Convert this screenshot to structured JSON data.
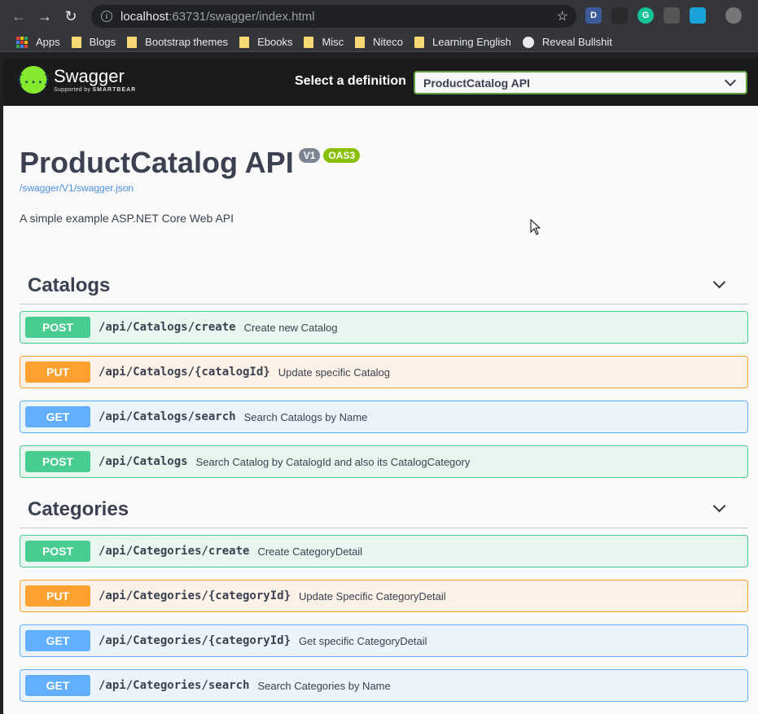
{
  "browser": {
    "url_host": "localhost",
    "url_rest": ":63731/swagger/index.html",
    "extensions": [
      {
        "name": "d-extension-icon",
        "letter": "D",
        "bg": "#3d5a98"
      },
      {
        "name": "dark-extension-icon",
        "letter": "",
        "bg": "#2a2a2a"
      },
      {
        "name": "grammarly-icon",
        "letter": "G",
        "bg": "#15c39a"
      },
      {
        "name": "bulb-extension-icon",
        "letter": "",
        "bg": "#555"
      },
      {
        "name": "blue-extension-icon",
        "letter": "",
        "bg": "#1aa3d9"
      },
      {
        "name": "profile-avatar-icon",
        "letter": "",
        "bg": "#777"
      }
    ],
    "bookmarks": [
      {
        "label": "Apps",
        "type": "apps"
      },
      {
        "label": "Blogs",
        "type": "folder"
      },
      {
        "label": "Bootstrap themes",
        "type": "folder"
      },
      {
        "label": "Ebooks",
        "type": "folder"
      },
      {
        "label": "Misc",
        "type": "folder"
      },
      {
        "label": "Niteco",
        "type": "folder"
      },
      {
        "label": "Learning English",
        "type": "folder"
      },
      {
        "label": "Reveal Bullshit",
        "type": "globe"
      }
    ]
  },
  "topbar": {
    "brand": "Swagger",
    "logo_glyph": "{...}",
    "supported_by": "Supported by",
    "smartbear": "SMARTBEAR",
    "select_label": "Select a definition",
    "selected_definition": "ProductCatalog API"
  },
  "info": {
    "title": "ProductCatalog API",
    "version_badge": "V1",
    "oas_badge": "OAS3",
    "json_link": "/swagger/V1/swagger.json",
    "description": "A simple example ASP.NET Core Web API"
  },
  "tags": [
    {
      "name": "Catalogs",
      "operations": [
        {
          "method": "POST",
          "path": "/api/Catalogs/create",
          "summary": "Create new Catalog"
        },
        {
          "method": "PUT",
          "path": "/api/Catalogs/{catalogId}",
          "summary": "Update specific Catalog"
        },
        {
          "method": "GET",
          "path": "/api/Catalogs/search",
          "summary": "Search Catalogs by Name"
        },
        {
          "method": "POST",
          "path": "/api/Catalogs",
          "summary": "Search Catalog by CatalogId and also its CatalogCategory"
        }
      ]
    },
    {
      "name": "Categories",
      "operations": [
        {
          "method": "POST",
          "path": "/api/Categories/create",
          "summary": "Create CategoryDetail"
        },
        {
          "method": "PUT",
          "path": "/api/Categories/{categoryId}",
          "summary": "Update Specific CategoryDetail"
        },
        {
          "method": "GET",
          "path": "/api/Categories/{categoryId}",
          "summary": "Get specific CategoryDetail"
        },
        {
          "method": "GET",
          "path": "/api/Categories/search",
          "summary": "Search Categories by Name"
        }
      ]
    }
  ],
  "colors": {
    "post": "#49cc90",
    "put": "#fca130",
    "get": "#61affe",
    "swagger_green": "#85ea2d"
  }
}
